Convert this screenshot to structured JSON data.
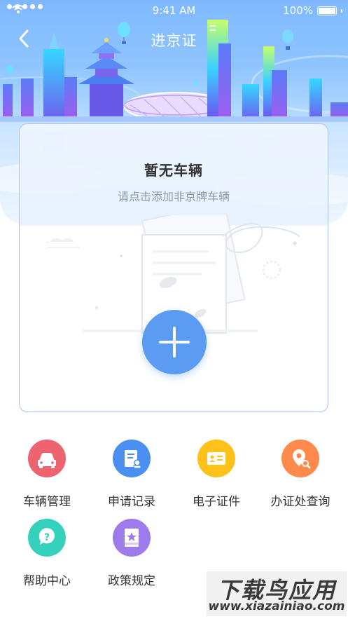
{
  "status_bar": {
    "time": "9:41 AM",
    "battery": "100%"
  },
  "header": {
    "title": "进京证",
    "back_icon": "chevron-left-icon"
  },
  "vehicle_card": {
    "title": "暂无车辆",
    "subtitle": "请点击添加非京牌车辆",
    "add_icon": "plus-icon"
  },
  "functions": [
    {
      "label": "车辆管理",
      "icon": "car-icon",
      "color": "#ee6370"
    },
    {
      "label": "申请记录",
      "icon": "document-person-icon",
      "color": "#4b8ff2"
    },
    {
      "label": "电子证件",
      "icon": "id-card-icon",
      "color": "#ffc21a"
    },
    {
      "label": "办证处查询",
      "icon": "location-search-icon",
      "color": "#ff8a4c"
    },
    {
      "label": "帮助中心",
      "icon": "question-icon",
      "color": "#36d1bd"
    },
    {
      "label": "政策规定",
      "icon": "book-star-icon",
      "color": "#9d7bea"
    }
  ],
  "watermark": {
    "main": "下载鸟应用",
    "sub": "www.xiazainiao.com"
  },
  "colors": {
    "primary": "#5b9bf2",
    "card_border": "#a8c4ee",
    "subtitle": "#8d99ad"
  }
}
